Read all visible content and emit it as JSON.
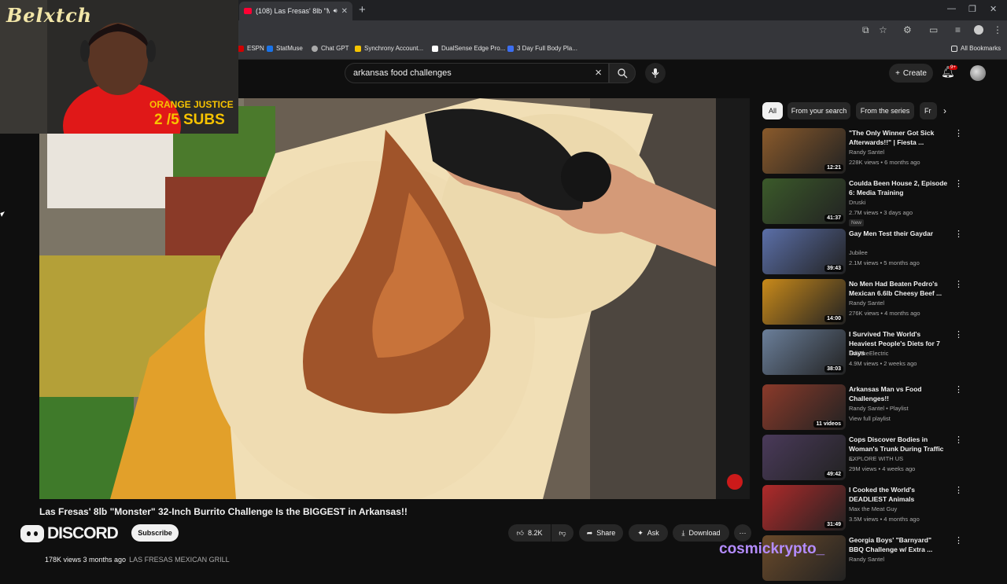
{
  "browser": {
    "tab_title": "(108) Las Fresas' 8lb \"Monst",
    "window_buttons": [
      "—",
      "❐",
      "✕"
    ],
    "bookmarks": [
      {
        "label": "ESPN",
        "color": "#d00000"
      },
      {
        "label": "StatMuse",
        "color": "#1a73e8"
      },
      {
        "label": "Chat GPT",
        "color": "#aaaaaa"
      },
      {
        "label": "Synchrony Account...",
        "color": "#f5c400"
      },
      {
        "label": "DualSense Edge Pro...",
        "color": "#ffffff"
      },
      {
        "label": "3 Day Full Body Pla...",
        "color": "#3c6ef0"
      }
    ],
    "all_bookmarks": "All Bookmarks"
  },
  "overlay": {
    "streamer_logo": "Belxtch",
    "goal_label": "ORANGE JUSTICE",
    "goal_progress": "2  /5 SUBS",
    "discord": "DISCORD",
    "cosmick": "cosmickrypto_"
  },
  "header": {
    "search_value": "arkansas food challenges",
    "create_label": "Create",
    "notifications_badge": "9+"
  },
  "video": {
    "title": "Las Fresas' 8lb \"Monster\" 32-Inch Burrito Challenge Is the BIGGEST in Arkansas!!",
    "subscribe_label": "Subscribe",
    "likes": "8.2K",
    "share_label": "Share",
    "ask_label": "Ask",
    "download_label": "Download",
    "views_line": "178K views  3 months ago",
    "channel_name": "LAS FRESAS MEXICAN GRILL"
  },
  "chips": [
    "All",
    "From your search",
    "From the series",
    "Fr"
  ],
  "recommendations": [
    {
      "title": "\"The Only Winner Got Sick Afterwards!!\" | Fiesta ...",
      "channel": "Randy Santel",
      "meta": "228K views • 6 months ago",
      "duration": "12:21",
      "badge": "",
      "thumb": "#8a5a2b"
    },
    {
      "title": "Coulda Been House 2, Episode 6: Media Training",
      "channel": "Druski",
      "meta": "2.7M views • 3 days ago",
      "duration": "41:37",
      "badge": "New",
      "thumb": "#3b5a2a"
    },
    {
      "title": "Gay Men Test their Gaydar",
      "channel": "Jubilee",
      "meta": "2.1M views • 5 months ago",
      "duration": "39:43",
      "badge": "",
      "thumb": "#5b6fa8"
    },
    {
      "title": "No Men Had Beaten Pedro's Mexican 6.6lb Cheesy Beef ...",
      "channel": "Randy Santel",
      "meta": "276K views • 4 months ago",
      "duration": "14:00",
      "badge": "",
      "thumb": "#c98a1a"
    },
    {
      "title": "I Survived The World's Heaviest People's Diets for 7 Days",
      "channel": "ErikTheElectric",
      "meta": "4.9M views • 2 weeks ago",
      "duration": "38:03",
      "badge": "",
      "thumb": "#6b7f9a"
    },
    {
      "title": "Arkansas Man vs Food Challenges!!",
      "channel": "Randy Santel • Playlist",
      "meta": "View full playlist",
      "duration": "11 videos",
      "badge": "",
      "thumb": "#8b3a2a"
    },
    {
      "title": "Cops Discover Bodies in Woman's Trunk During Traffic ...",
      "channel": "EXPLORE WITH US",
      "meta": "29M views • 4 weeks ago",
      "duration": "49:42",
      "badge": "",
      "thumb": "#4a3a5a"
    },
    {
      "title": "I Cooked the World's DEADLIEST Animals",
      "channel": "Max the Meat Guy",
      "meta": "3.5M views • 4 months ago",
      "duration": "31:49",
      "badge": "",
      "thumb": "#b02a2a"
    },
    {
      "title": "Georgia Boys' \"Barnyard\" BBQ Challenge w/ Extra ...",
      "channel": "Randy Santel",
      "meta": "",
      "duration": "",
      "badge": "",
      "thumb": "#6a4a2a"
    }
  ]
}
